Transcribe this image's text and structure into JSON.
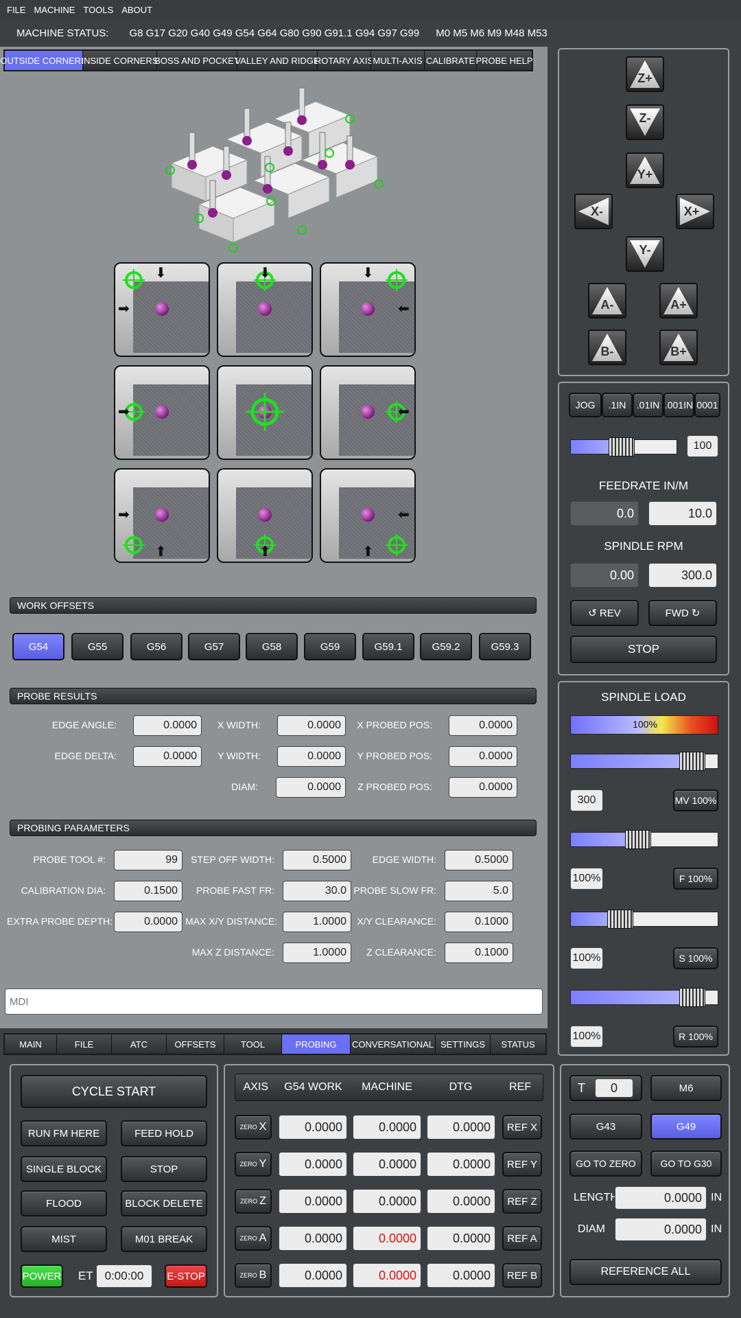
{
  "menu": [
    "FILE",
    "MACHINE",
    "TOOLS",
    "ABOUT"
  ],
  "status": {
    "label": "MACHINE STATUS:",
    "gcodes": "G8 G17 G20 G40 G49 G54 G64 G80 G90 G91.1 G94 G97 G99",
    "mcodes": "M0 M5 M6 M9 M48 M53"
  },
  "probe_tabs": [
    "OUTSIDE CORNERS",
    "INSIDE CORNERS",
    "BOSS AND POCKET",
    "VALLEY AND RIDGE",
    "ROTARY AXIS",
    "MULTI-AXIS",
    "CALIBRATE",
    "PROBE HELP"
  ],
  "work_offsets": {
    "title": "WORK OFFSETS",
    "items": [
      "G54",
      "G55",
      "G56",
      "G57",
      "G58",
      "G59",
      "G59.1",
      "G59.2",
      "G59.3"
    ]
  },
  "probe_results": {
    "title": "PROBE RESULTS",
    "edge_angle": {
      "label": "EDGE ANGLE:",
      "value": "0.0000"
    },
    "edge_delta": {
      "label": "EDGE DELTA:",
      "value": "0.0000"
    },
    "x_width": {
      "label": "X WIDTH:",
      "value": "0.0000"
    },
    "y_width": {
      "label": "Y WIDTH:",
      "value": "0.0000"
    },
    "diam": {
      "label": "DIAM:",
      "value": "0.0000"
    },
    "x_probed": {
      "label": "X PROBED POS:",
      "value": "0.0000"
    },
    "y_probed": {
      "label": "Y PROBED POS:",
      "value": "0.0000"
    },
    "z_probed": {
      "label": "Z PROBED POS:",
      "value": "0.0000"
    }
  },
  "probing_params": {
    "title": "PROBING PARAMETERS",
    "tool": {
      "label": "PROBE TOOL #:",
      "value": "99"
    },
    "cal_dia": {
      "label": "CALIBRATION DIA:",
      "value": "0.1500"
    },
    "extra_depth": {
      "label": "EXTRA PROBE DEPTH:",
      "value": "0.0000"
    },
    "step_off": {
      "label": "STEP OFF WIDTH:",
      "value": "0.5000"
    },
    "fast_fr": {
      "label": "PROBE FAST FR:",
      "value": "30.0"
    },
    "max_xy": {
      "label": "MAX X/Y DISTANCE:",
      "value": "1.0000"
    },
    "max_z": {
      "label": "MAX Z DISTANCE:",
      "value": "1.0000"
    },
    "edge_width": {
      "label": "EDGE WIDTH:",
      "value": "0.5000"
    },
    "slow_fr": {
      "label": "PROBE SLOW FR:",
      "value": "5.0"
    },
    "xy_clear": {
      "label": "X/Y CLEARANCE:",
      "value": "0.1000"
    },
    "z_clear": {
      "label": "Z CLEARANCE:",
      "value": "0.1000"
    }
  },
  "mdi": {
    "placeholder": "MDI"
  },
  "main_tabs": [
    "MAIN",
    "FILE",
    "ATC",
    "OFFSETS",
    "TOOL",
    "PROBING",
    "CONVERSATIONAL",
    "SETTINGS",
    "STATUS"
  ],
  "jog": {
    "zplus": "Z+",
    "zminus": "Z-",
    "yplus": "Y+",
    "yminus": "Y-",
    "xminus": "X-",
    "xplus": "X+",
    "aminus": "A-",
    "aplus": "A+",
    "bminus": "B-",
    "bplus": "B+"
  },
  "jog_steps": [
    "JOG",
    ".1IN",
    ".01IN",
    ".001IN",
    "0001"
  ],
  "jog_rate": {
    "value": "100",
    "level": 0.47
  },
  "feed": {
    "title": "FEEDRATE IN/M",
    "actual": "0.0",
    "set": "10.0"
  },
  "spindle": {
    "title": "SPINDLE RPM",
    "actual": "0.00",
    "set": "300.0",
    "rev": "REV",
    "fwd": "FWD",
    "stop": "STOP"
  },
  "load": {
    "title": "SPINDLE LOAD",
    "percent": "100%",
    "level": 1.0
  },
  "overrides": {
    "mv": {
      "value": "300",
      "button": "MV 100%",
      "level": 0.9
    },
    "f": {
      "value": "100%",
      "button": "F 100%",
      "level": 0.45
    },
    "s": {
      "value": "100%",
      "button": "S 100%",
      "level": 0.3
    },
    "r": {
      "value": "100%",
      "button": "R 100%",
      "level": 0.9
    }
  },
  "controls": {
    "cycle_start": "CYCLE START",
    "run_from_here": "RUN FM HERE",
    "feed_hold": "FEED HOLD",
    "single_block": "SINGLE BLOCK",
    "stop": "STOP",
    "flood": "FLOOD",
    "block_delete": "BLOCK DELETE",
    "mist": "MIST",
    "m01_break": "M01 BREAK",
    "power": "POWER",
    "et_label": "ET",
    "et_value": "0:00:00",
    "estop": "E-STOP"
  },
  "dro": {
    "headers": [
      "AXIS",
      "G54 WORK",
      "MACHINE",
      "DTG",
      "REF"
    ],
    "zero_label": "ZERO",
    "rows": [
      {
        "axis": "X",
        "work": "0.0000",
        "machine": "0.0000",
        "dtg": "0.0000",
        "ref": "REF X"
      },
      {
        "axis": "Y",
        "work": "0.0000",
        "machine": "0.0000",
        "dtg": "0.0000",
        "ref": "REF Y"
      },
      {
        "axis": "Z",
        "work": "0.0000",
        "machine": "0.0000",
        "dtg": "0.0000",
        "ref": "REF Z"
      },
      {
        "axis": "A",
        "work": "0.0000",
        "machine": "0.0000",
        "dtg": "0.0000",
        "ref": "REF A"
      },
      {
        "axis": "B",
        "work": "0.0000",
        "machine": "0.0000",
        "dtg": "0.0000",
        "ref": "REF B"
      }
    ]
  },
  "tool": {
    "t_label": "T",
    "t_value": "0",
    "m6": "M6",
    "g43": "G43",
    "g49": "G49",
    "go_zero": "GO TO ZERO",
    "go_g30": "GO TO G30",
    "length_label": "LENGTH",
    "length_value": "0.0000",
    "diam_label": "DIAM",
    "diam_value": "0.0000",
    "unit": "IN",
    "reference_all": "REFERENCE ALL"
  },
  "colors": {
    "accent": "#6a70f0",
    "red_value": "#e01010",
    "green_target": "#22dd22"
  }
}
